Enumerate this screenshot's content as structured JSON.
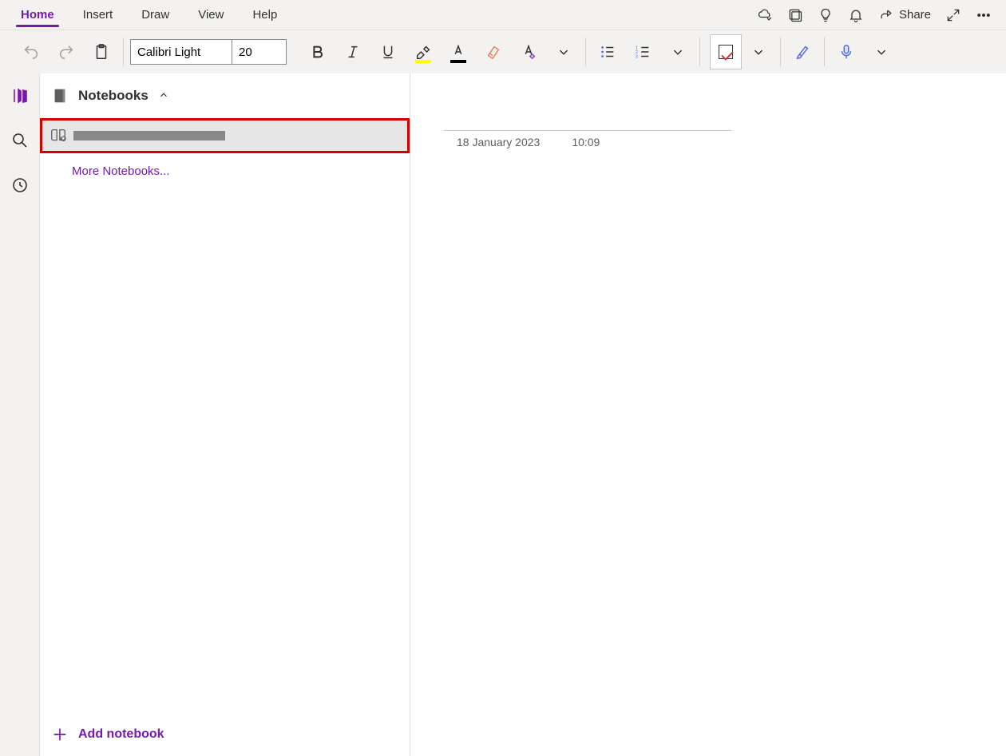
{
  "tabs": {
    "home": "Home",
    "insert": "Insert",
    "draw": "Draw",
    "view": "View",
    "help": "Help"
  },
  "titlebar": {
    "share_label": "Share"
  },
  "ribbon": {
    "font_name": "Calibri Light",
    "font_size": "20",
    "highlight_color": "#ffff00",
    "font_color": "#000000"
  },
  "sidebar": {
    "header_label": "Notebooks",
    "more_label": "More Notebooks...",
    "add_label": "Add notebook"
  },
  "page": {
    "date": "18 January 2023",
    "time": "10:09"
  }
}
